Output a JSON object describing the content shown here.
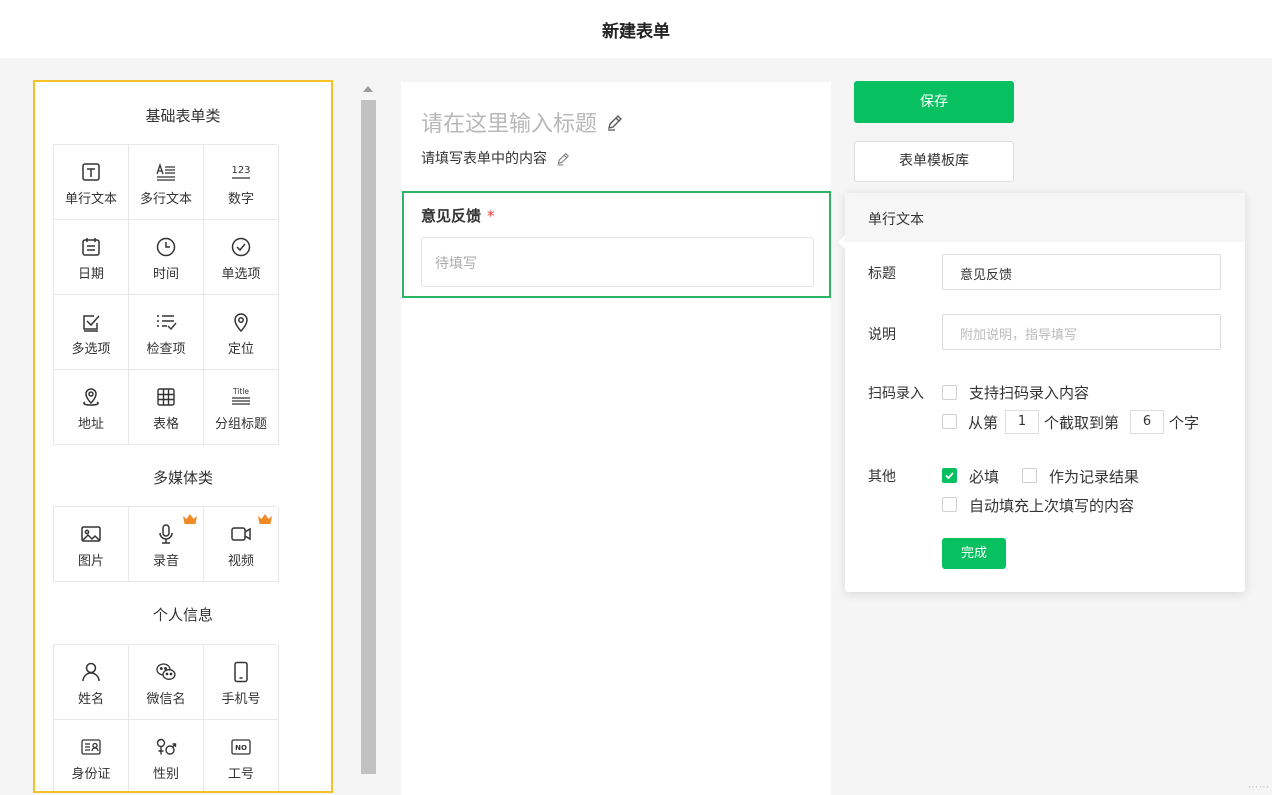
{
  "header": {
    "title": "新建表单"
  },
  "palette": {
    "sections": [
      {
        "title": "基础表单类",
        "items": [
          {
            "label": "单行文本",
            "icon": "text-icon"
          },
          {
            "label": "多行文本",
            "icon": "multiline-text-icon"
          },
          {
            "label": "数字",
            "icon": "number-icon",
            "glyph": "123"
          },
          {
            "label": "日期",
            "icon": "calendar-icon"
          },
          {
            "label": "时间",
            "icon": "clock-icon"
          },
          {
            "label": "单选项",
            "icon": "radio-check-icon"
          },
          {
            "label": "多选项",
            "icon": "checkbox-icon"
          },
          {
            "label": "检查项",
            "icon": "checklist-icon"
          },
          {
            "label": "定位",
            "icon": "location-pin-icon"
          },
          {
            "label": "地址",
            "icon": "address-pin-icon"
          },
          {
            "label": "表格",
            "icon": "table-icon"
          },
          {
            "label": "分组标题",
            "icon": "group-title-icon",
            "glyph": "Title"
          }
        ]
      },
      {
        "title": "多媒体类",
        "items": [
          {
            "label": "图片",
            "icon": "image-icon"
          },
          {
            "label": "录音",
            "icon": "microphone-icon",
            "premium": true
          },
          {
            "label": "视频",
            "icon": "video-icon",
            "premium": true
          }
        ]
      },
      {
        "title": "个人信息",
        "items": [
          {
            "label": "姓名",
            "icon": "person-icon"
          },
          {
            "label": "微信名",
            "icon": "wechat-icon"
          },
          {
            "label": "手机号",
            "icon": "phone-icon"
          },
          {
            "label": "身份证",
            "icon": "id-card-icon"
          },
          {
            "label": "性别",
            "icon": "gender-icon"
          },
          {
            "label": "工号",
            "icon": "employee-number-icon",
            "glyph": "NO"
          }
        ]
      }
    ]
  },
  "canvas": {
    "title_placeholder": "请在这里输入标题",
    "desc_placeholder": "请填写表单中的内容",
    "field": {
      "label": "意见反馈",
      "required_mark": "*",
      "input_placeholder": "待填写"
    }
  },
  "actions": {
    "save": "保存",
    "template_library": "表单模板库"
  },
  "props": {
    "header": "单行文本",
    "title_label": "标题",
    "title_value": "意见反馈",
    "desc_label": "说明",
    "desc_placeholder": "附加说明，指导填写",
    "scan_label": "扫码录入",
    "scan_support": "支持扫码录入内容",
    "scan_from": "从第",
    "scan_from_value": "1",
    "scan_mid": "个截取到第",
    "scan_to_value": "6",
    "scan_suffix": "个字",
    "other_label": "其他",
    "required": "必填",
    "as_result": "作为记录结果",
    "autofill": "自动填充上次填写的内容",
    "done": "完成"
  },
  "colors": {
    "accent": "#07c160",
    "highlight_border": "#f5c02a",
    "selected_field": "#2fb466",
    "required": "#e53935",
    "premium": "#f08a24"
  }
}
